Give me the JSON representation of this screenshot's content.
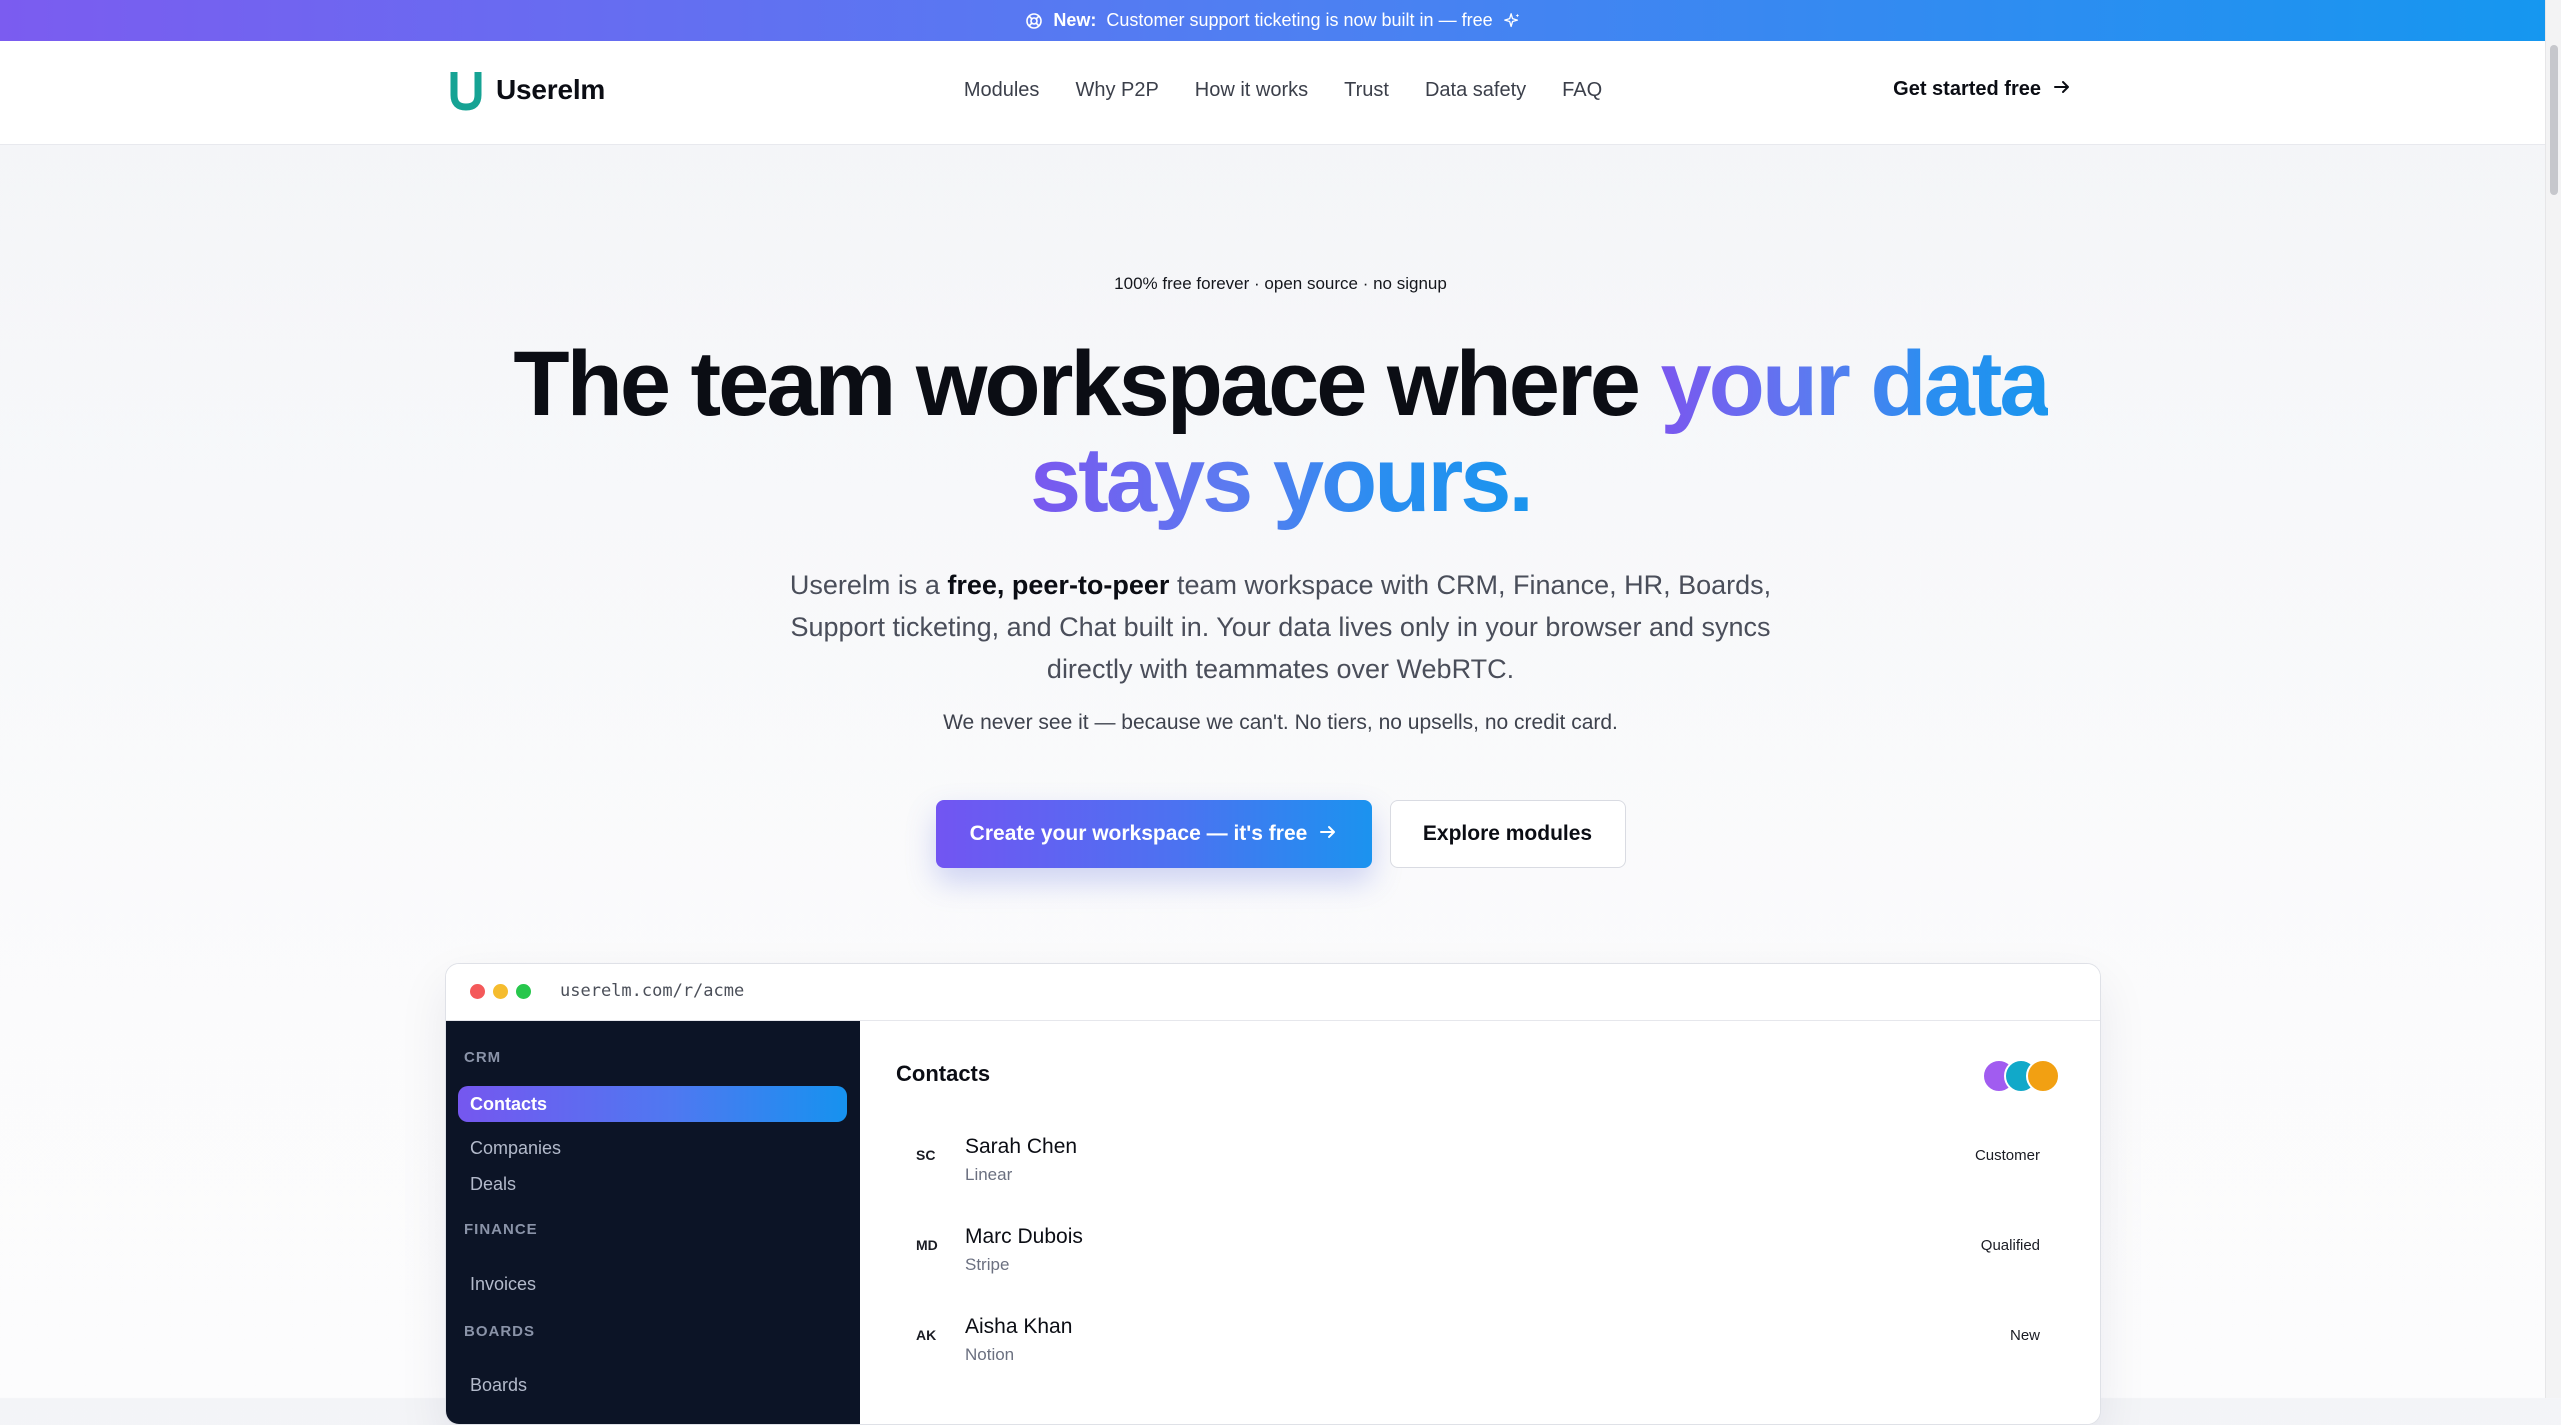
{
  "announcement": {
    "badge": "New:",
    "text": "Customer support ticketing is now built in — free"
  },
  "brand": {
    "name": "Userelm",
    "logo_letter": "U",
    "accent": "#16a394"
  },
  "nav": {
    "links": [
      "Modules",
      "Why P2P",
      "How it works",
      "Trust",
      "Data safety",
      "FAQ"
    ],
    "cta": "Get started free"
  },
  "hero": {
    "eyebrow": "100% free forever · open source · no signup",
    "headline_plain": "The team workspace where ",
    "headline_highlight_1": "your data",
    "headline_highlight_2": "stays yours.",
    "sub_1": "Userelm is a ",
    "sub_bold": "free, peer-to-peer",
    "sub_2": " team workspace with CRM, Finance, HR, Boards,",
    "sub_line2": "Support ticketing, and Chat built in. Your data lives only in your browser and syncs",
    "sub_line3": "directly with teammates over WebRTC.",
    "note": "We never see it — because we can't. No tiers, no upsells, no credit card.",
    "primary_cta": "Create your workspace — it's free",
    "secondary_cta": "Explore modules"
  },
  "preview": {
    "url": "userelm.com/r/acme",
    "sidebar": {
      "sections": [
        {
          "heading": "CRM",
          "items": [
            "Contacts",
            "Companies",
            "Deals"
          ]
        },
        {
          "heading": "FINANCE",
          "items": [
            "Invoices"
          ]
        },
        {
          "heading": "BOARDS",
          "items": [
            "Boards"
          ]
        }
      ],
      "active_item": "Contacts"
    },
    "main": {
      "title": "Contacts",
      "rows": [
        {
          "initials": "SC",
          "name": "Sarah Chen",
          "company": "Linear",
          "status": "Customer"
        },
        {
          "initials": "MD",
          "name": "Marc Dubois",
          "company": "Stripe",
          "status": "Qualified"
        },
        {
          "initials": "AK",
          "name": "Aisha Khan",
          "company": "Notion",
          "status": "New"
        }
      ]
    }
  },
  "colors": {
    "gradient_start": "#7a57ef",
    "gradient_end": "#1a95ee",
    "sidebar_bg": "#0c1426"
  }
}
